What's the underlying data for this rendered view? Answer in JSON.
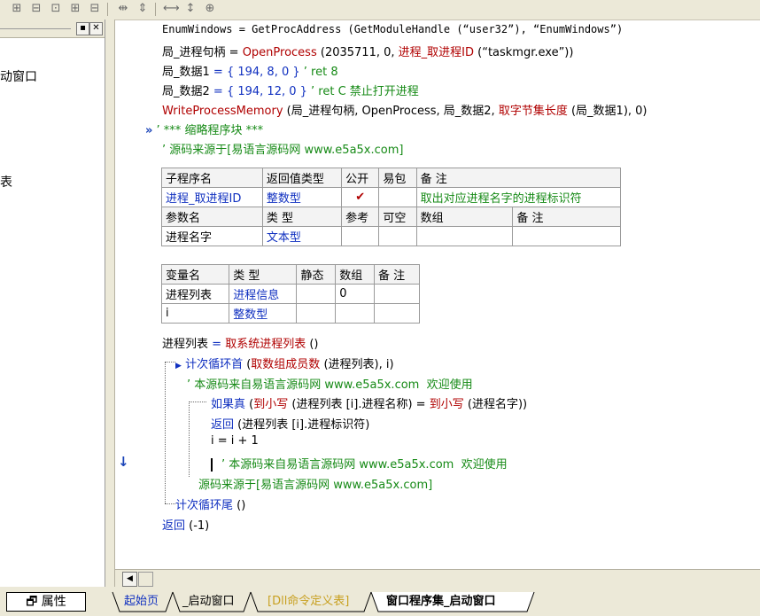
{
  "toolbar": {
    "icons": [
      "align-left-icon",
      "align-top-icon",
      "align-center-icon",
      "align-right-icon",
      "space-horizontal-icon",
      "space-vertical-icon",
      "width-icon",
      "height-icon",
      "size-icon"
    ]
  },
  "left_panel": {
    "items": [
      "动窗口",
      "表"
    ]
  },
  "code": {
    "l1": "EnumWindows = GetProcAddress (GetModuleHandle (“user32”), “EnumWindows”)",
    "l2a": "局_进程句柄",
    "l2b": " = ",
    "l2c": "OpenProcess",
    "l2d": " (2035711, 0, ",
    "l2e": "进程_取进程ID",
    "l2f": " (“taskmgr.exe”))",
    "l3a": "局_数据1",
    "l3b": " = { 194, 8, 0 } ",
    "l3c": "’ ret 8",
    "l4a": "局_数据2",
    "l4b": " = { 194, 12, 0 } ",
    "l4c": "’ ret C 禁止打开进程",
    "l5a": "WriteProcessMemory",
    "l5b": " (局_进程句柄, OpenProcess, 局_数据2, ",
    "l5c": "取字节集长度",
    "l5d": " (局_数据1), 0)",
    "l6mark": "»",
    "l6": "’ *** 缩略程序块 ***",
    "l7": "’ 源码来源于[易语言源码网 www.e5a5x.com]"
  },
  "sub_table": {
    "header": [
      "子程序名",
      "返回值类型",
      "公开",
      "易包",
      "备 注"
    ],
    "row": [
      "进程_取进程ID",
      "整数型",
      "✔",
      "",
      "取出对应进程名字的进程标识符"
    ],
    "param_header": [
      "参数名",
      "类 型",
      "参考",
      "可空",
      "数组",
      "备 注"
    ],
    "param_row": [
      "进程名字",
      "文本型",
      "",
      "",
      "",
      ""
    ]
  },
  "var_table": {
    "header": [
      "变量名",
      "类 型",
      "静态",
      "数组",
      "备 注"
    ],
    "rows": [
      [
        "进程列表",
        "进程信息",
        "",
        "0",
        ""
      ],
      [
        "i",
        "整数型",
        "",
        "",
        ""
      ]
    ]
  },
  "body": {
    "b1a": "进程列表",
    "b1b": " = ",
    "b1c": "取系统进程列表",
    "b1d": " ()",
    "b2a": "计次循环首",
    "b2b": " (",
    "b2c": "取数组成员数",
    "b2d": " (进程列表), i)",
    "b3": "’ 本源码来自易语言源码网 www.e5a5x.com  欢迎使用",
    "b4a": "如果真",
    "b4b": " (",
    "b4c": "到小写",
    "b4d": " (进程列表 [i].进程名称) = ",
    "b4e": "到小写",
    "b4f": " (进程名字))",
    "b5a": "返回",
    "b5b": " (进程列表 [i].进程标识符)",
    "b6": "i = i + 1",
    "b7": "’ 本源码来自易语言源码网 www.e5a5x.com  欢迎使用",
    "b8": "源码来源于[易语言源码网 www.e5a5x.com]",
    "b9a": "计次循环尾",
    "b9b": " ()",
    "b10a": "返回",
    "b10b": " (-1)"
  },
  "bottom_tabs": {
    "properties": "属性",
    "tabs": [
      "起始页",
      "_启动窗口",
      "[Dll命令定义表]",
      "窗口程序集_启动窗口"
    ]
  }
}
